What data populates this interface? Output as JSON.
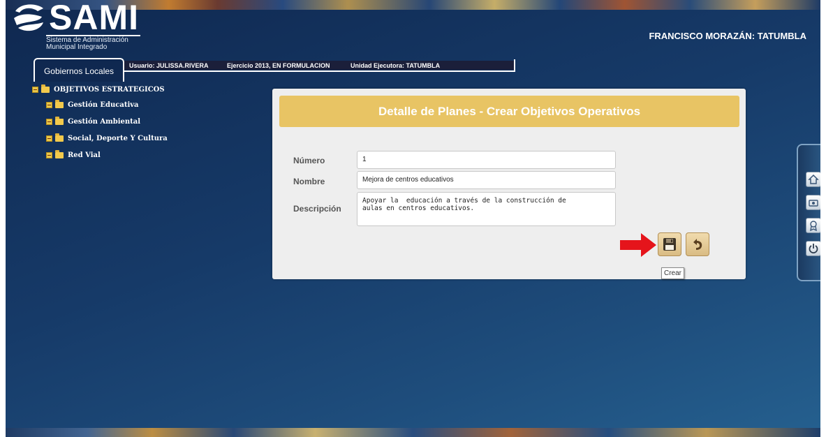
{
  "header": {
    "logo_title": "SAMI",
    "logo_sub_line1": "Sistema de Administración",
    "logo_sub_line2": "Municipal Integrado",
    "municipality": "FRANCISCO MORAZÁN: TATUMBLA"
  },
  "tabs": {
    "active_tab": "Gobiernos Locales",
    "usuario": "Usuario: JULISSA.RIVERA",
    "ejercicio": "Ejercicio 2013, EN FORMULACION",
    "unidad": "Unidad Ejecutora: TATUMBLA"
  },
  "tree": {
    "root": "OBJETIVOS ESTRATEGICOS",
    "children": [
      "Gestión Educativa",
      "Gestión Ambiental",
      "Social, Deporte Y Cultura",
      "Red Vial"
    ]
  },
  "panel": {
    "title": "Detalle de Planes - Crear Objetivos Operativos",
    "numero_label": "Número",
    "numero_value": "1",
    "nombre_label": "Nombre",
    "nombre_value": "Mejora de centros educativos",
    "descripcion_label": "Descripción",
    "descripcion_value": "Apoyar la  educación a través de la construcción de\naulas en centros educativos.",
    "save_icon": "save-disk-icon",
    "undo_icon": "undo-arrow-icon",
    "tooltip": "Crear"
  },
  "dock": {
    "icons": [
      "home-icon",
      "ticket-icon",
      "award-icon",
      "power-icon"
    ]
  },
  "colors": {
    "panel_header": "#e8c464",
    "background": "#163a68",
    "arrow": "#e5141b"
  }
}
